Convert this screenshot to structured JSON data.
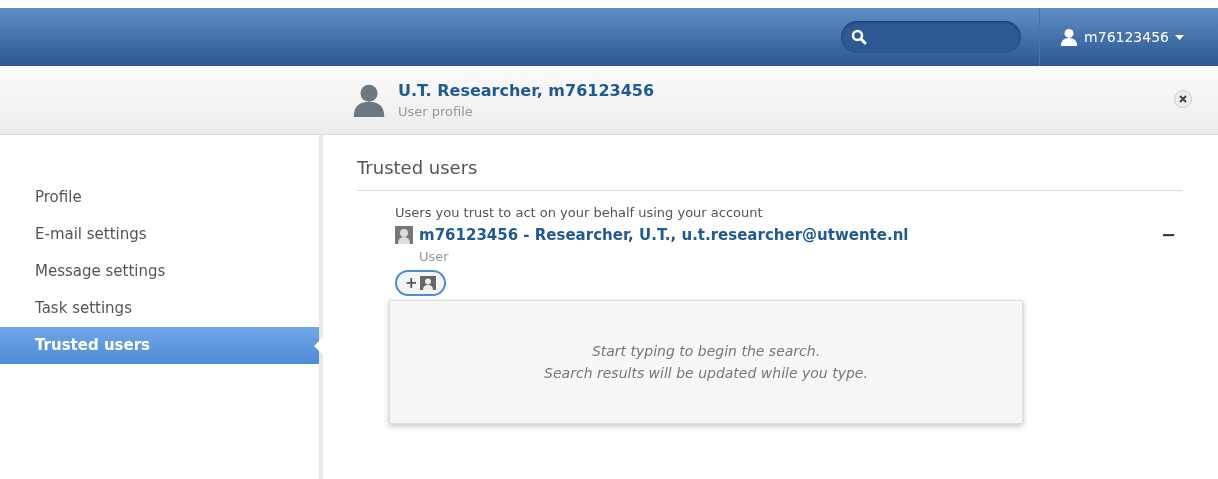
{
  "topbar": {
    "user_menu": {
      "label": "m76123456"
    }
  },
  "header": {
    "title": "U.T. Researcher, m76123456",
    "subtitle": "User profile"
  },
  "sidebar": {
    "items": [
      {
        "label": "Profile",
        "selected": false
      },
      {
        "label": "E-mail settings",
        "selected": false
      },
      {
        "label": "Message settings",
        "selected": false
      },
      {
        "label": "Task settings",
        "selected": false
      },
      {
        "label": "Trusted users",
        "selected": true
      }
    ]
  },
  "content": {
    "title": "Trusted users",
    "description": "Users you trust to act on your behalf using your account",
    "users": [
      {
        "name": "m76123456 - Researcher, U.T., u.t.researcher@utwente.nl",
        "role": "User",
        "remove": "−"
      }
    ],
    "add_button": {
      "label": "+"
    },
    "search_popup": {
      "lines": [
        "Start typing to begin the search.",
        "Search results will be updated while you type."
      ]
    }
  }
}
